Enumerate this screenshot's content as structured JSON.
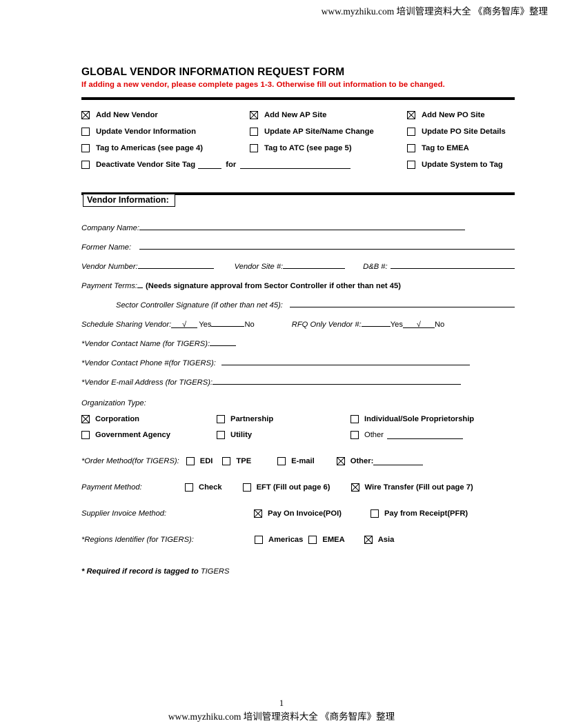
{
  "watermark": {
    "top": "www.myzhiku.com 培训管理资料大全  《商务智库》整理",
    "bottom": "www.myzhiku.com 培训管理资料大全  《商务智库》整理",
    "page_number": "1"
  },
  "title": "GLOBAL VENDOR INFORMATION REQUEST FORM",
  "subtitle": "If adding a new vendor, please complete pages 1-3.   Otherwise fill out information to be changed.",
  "subtitle_color": "#e00000",
  "request_options": {
    "rows": [
      {
        "c1": {
          "label": "Add New Vendor",
          "checked": true
        },
        "c2": {
          "label": "Add New AP Site",
          "checked": true
        },
        "c3": {
          "label": "Add New PO Site",
          "checked": true
        }
      },
      {
        "c1": {
          "label": "Update Vendor Information",
          "checked": false
        },
        "c2": {
          "label": "Update AP Site/Name Change",
          "checked": false
        },
        "c3": {
          "label": "Update PO Site Details",
          "checked": false
        }
      },
      {
        "c1": {
          "label": "Tag to Americas (see page 4)",
          "checked": false
        },
        "c2": {
          "label": "Tag to ATC (see page 5)",
          "checked": false
        },
        "c3": {
          "label": "Tag to EMEA",
          "checked": false
        }
      }
    ],
    "deactivate": {
      "label_a": "Deactivate Vendor Site Tag",
      "label_b": "for",
      "checked": false,
      "tag_value": "",
      "for_value": ""
    },
    "update_system": {
      "label": "Update System to Tag",
      "checked": false
    }
  },
  "vendor_section": {
    "heading": "Vendor Information:",
    "company_name": {
      "label": "Company Name:",
      "value": ""
    },
    "former_name": {
      "label": "Former Name:",
      "value": ""
    },
    "vendor_number": {
      "label": "Vendor Number:",
      "value": ""
    },
    "vendor_site": {
      "label": "Vendor Site #:",
      "value": ""
    },
    "dnb": {
      "label": "D&B #:",
      "value": ""
    },
    "payment_terms": {
      "label": "Payment Terms:",
      "value": "",
      "note": "(Needs signature approval from Sector Controller if other than net 45)"
    },
    "sector_signature": {
      "label": "Sector Controller Signature (if other than net 45):",
      "value": ""
    },
    "schedule_sharing": {
      "label": "Schedule Sharing Vendor:",
      "yes_mark": "√",
      "yes_text": "Yes",
      "no_mark": "",
      "no_text": "No"
    },
    "rfq_only": {
      "label": "RFQ Only Vendor #:",
      "yes_mark": "",
      "yes_text": "Yes",
      "no_mark": "√",
      "no_text": "No"
    },
    "contact_name": {
      "label": "*Vendor Contact Name (for TIGERS):",
      "value": ""
    },
    "contact_phone": {
      "label": "*Vendor Contact Phone #(for TIGERS):",
      "value": ""
    },
    "contact_email": {
      "label": "*Vendor E-mail Address (for TIGERS):",
      "value": ""
    }
  },
  "organization_type": {
    "label": "Organization Type:",
    "row1": [
      {
        "label": "Corporation",
        "checked": true
      },
      {
        "label": "Partnership",
        "checked": false
      },
      {
        "label": "Individual/Sole Proprietorship",
        "checked": false
      }
    ],
    "row2": [
      {
        "label": "Government Agency",
        "checked": false
      },
      {
        "label": "Utility",
        "checked": false
      },
      {
        "label": "Other",
        "checked": false,
        "has_line": true,
        "value": ""
      }
    ]
  },
  "order_method": {
    "label": "*Order Method(for TIGERS):",
    "options": [
      {
        "label": "EDI",
        "checked": false
      },
      {
        "label": "TPE",
        "checked": false
      },
      {
        "label": "E-mail",
        "checked": false
      },
      {
        "label": "Other:",
        "checked": true,
        "has_line": true,
        "value": ""
      }
    ]
  },
  "payment_method": {
    "label": "Payment Method:",
    "options": [
      {
        "label": "Check",
        "checked": false
      },
      {
        "label": "EFT (Fill out page 6)",
        "checked": false
      },
      {
        "label": "Wire  Transfer (Fill out page 7)",
        "checked": true
      }
    ]
  },
  "supplier_invoice_method": {
    "label": "Supplier Invoice Method:",
    "options": [
      {
        "label": "Pay On Invoice(POI)",
        "checked": true
      },
      {
        "label": "Pay from Receipt(PFR)",
        "checked": false
      }
    ]
  },
  "regions_identifier": {
    "label": "*Regions Identifier (for TIGERS):",
    "options": [
      {
        "label": "Americas",
        "checked": false
      },
      {
        "label": "EMEA",
        "checked": false
      },
      {
        "label": "Asia",
        "checked": true
      }
    ]
  },
  "footnote": {
    "bold_part": "* Required if record is tagged to ",
    "plain_part": "TIGERS"
  }
}
